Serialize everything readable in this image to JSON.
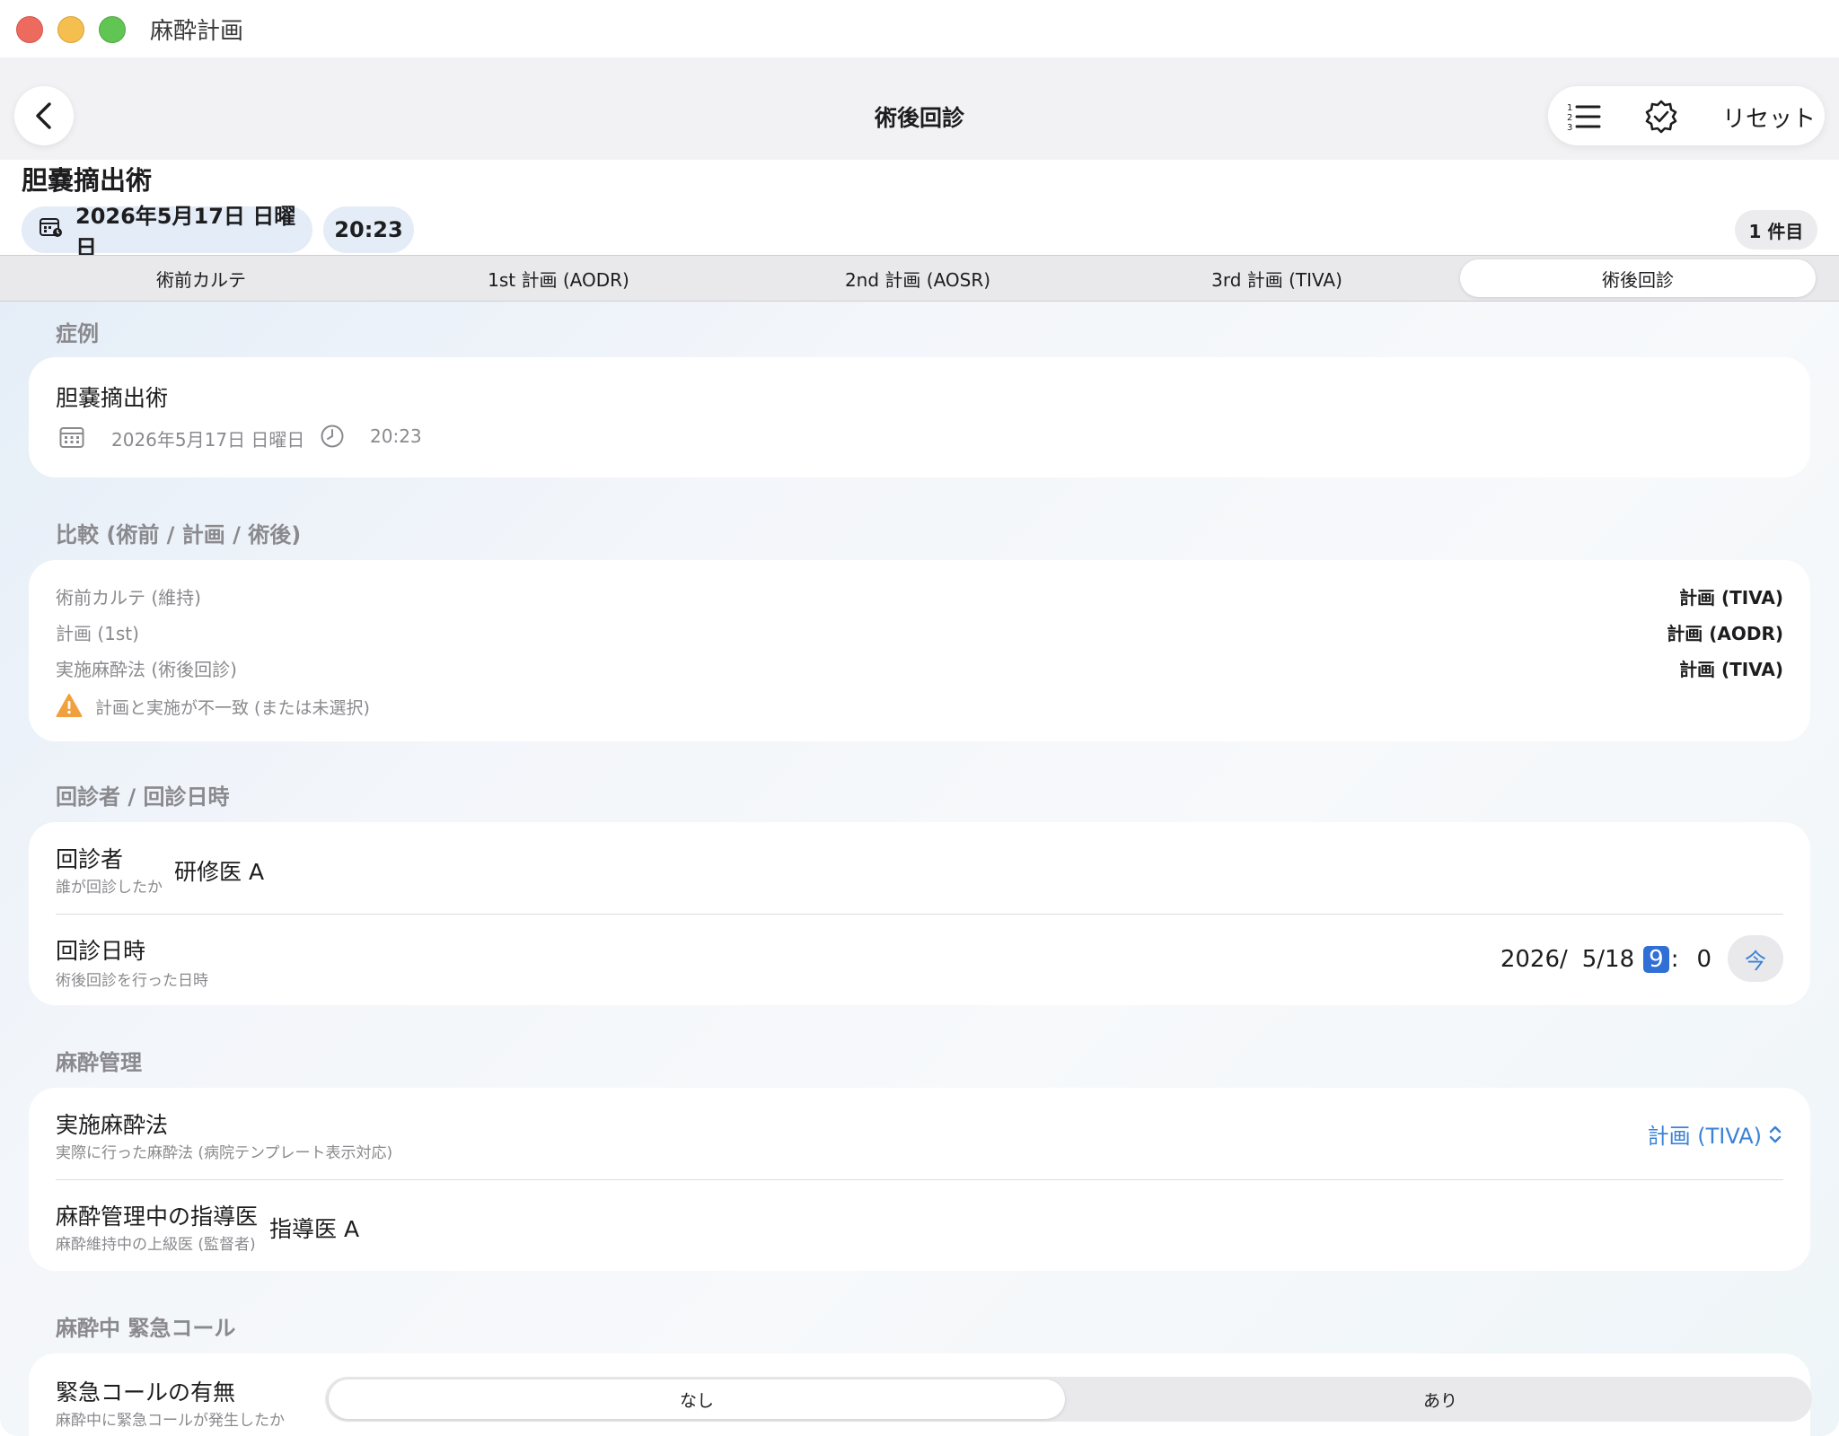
{
  "window": {
    "app_title": "麻酔計画"
  },
  "nav": {
    "title": "術後回診",
    "reset_label": "リセット"
  },
  "header": {
    "case_title": "胆嚢摘出術",
    "date": "2026年5月17日 日曜日",
    "time": "20:23",
    "count": "1 件目"
  },
  "tabs": [
    {
      "label": "術前カルテ"
    },
    {
      "label": "1st 計画 (AODR)"
    },
    {
      "label": "2nd 計画 (AOSR)"
    },
    {
      "label": "3rd 計画 (TIVA)"
    },
    {
      "label": "術後回診"
    }
  ],
  "active_tab": "術後回診",
  "case_section": {
    "label": "症例",
    "name": "胆嚢摘出術",
    "date": "2026年5月17日 日曜日",
    "time": "20:23"
  },
  "compare_section": {
    "label": "比較 (術前 / 計画 / 術後)",
    "rows": [
      {
        "label": "術前カルテ (維持)",
        "value": "計画 (TIVA)"
      },
      {
        "label": "計画 (1st)",
        "value": "計画 (AODR)"
      },
      {
        "label": "実施麻酔法 (術後回診)",
        "value": "計画 (TIVA)"
      }
    ],
    "warning": "計画と実施が不一致 (または未選択)",
    "warning_color": "#f0a03c"
  },
  "visit_section": {
    "label": "回診者 / 回診日時",
    "visitor_title": "回診者",
    "visitor_sub": "誰が回診したか",
    "visitor_value": "研修医 A",
    "datetime_title": "回診日時",
    "datetime_sub": "術後回診を行った日時",
    "dt_year": "2026/",
    "dt_date": "5/18",
    "dt_hour": "9",
    "dt_sep": ":",
    "dt_min": "0",
    "now_label": "今"
  },
  "anesthesia_section": {
    "label": "麻酔管理",
    "method_title": "実施麻酔法",
    "method_sub": "実際に行った麻酔法 (病院テンプレート表示対応)",
    "method_value": "計画 (TIVA)",
    "supervisor_title": "麻酔管理中の指導医",
    "supervisor_sub": "麻酔維持中の上級医 (監督者)",
    "supervisor_value": "指導医 A"
  },
  "emergency_section": {
    "label": "麻酔中 緊急コール",
    "title": "緊急コールの有無",
    "sub": "麻酔中に緊急コールが発生したか",
    "options": [
      "なし",
      "あり"
    ],
    "selected": "なし"
  },
  "colors": {
    "accent": "#3a82d6",
    "selection": "#2f6fd6"
  }
}
